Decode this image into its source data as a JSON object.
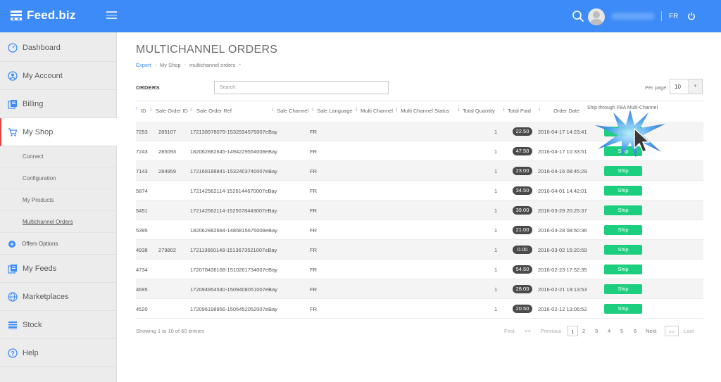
{
  "header": {
    "logo_text": "Feed.biz",
    "language": "FR",
    "accent_color": "#3d8bf8"
  },
  "sidebar": {
    "items": [
      {
        "label": "Dashboard",
        "icon": "dashboard-icon"
      },
      {
        "label": "My Account",
        "icon": "user-icon"
      },
      {
        "label": "Billing",
        "icon": "billing-icon"
      },
      {
        "label": "My Shop",
        "icon": "cart-icon",
        "active": true
      },
      {
        "label": "My Feeds",
        "icon": "feeds-icon"
      },
      {
        "label": "Marketplaces",
        "icon": "globe-icon"
      },
      {
        "label": "Stock",
        "icon": "stock-icon"
      },
      {
        "label": "Help",
        "icon": "help-icon"
      }
    ],
    "sub_items": [
      "Connect",
      "Configuration",
      "My Products",
      "Multichannel Orders"
    ],
    "offers_label": "Offers Options"
  },
  "page": {
    "title": "MULTICHANNEL ORDERS",
    "breadcrumb": [
      "Expert",
      "My Shop",
      "multichannel orders"
    ]
  },
  "toolbar": {
    "orders_label": "ORDERS",
    "search_placeholder": "Search:",
    "per_page_label": "Per page:",
    "per_page_value": "10"
  },
  "table": {
    "columns": [
      "ID",
      "Sale Order ID",
      "Sale Order Ref",
      "Sale Channel",
      "Sale Language",
      "Multi Channel",
      "Multi Channel Status",
      "Total Quantity",
      "Total Paid",
      "Order Date",
      "Ship through FBA Multi-Channel"
    ],
    "rows": [
      {
        "id": "7253",
        "sale_order_id": "285107",
        "sale_order_ref": "172138978079-1532934575007eBay",
        "lang": "FR",
        "qty": "1",
        "paid": "22.50",
        "date": "2016-04-17 14:23:41",
        "action": "Ship"
      },
      {
        "id": "7243",
        "sale_order_id": "285093",
        "sale_order_ref": "182062882645-1494229554008eBay",
        "lang": "FR",
        "qty": "1",
        "paid": "47.50",
        "date": "2016-04-17 10:33:51",
        "action": "Ship"
      },
      {
        "id": "7143",
        "sale_order_id": "284959",
        "sale_order_ref": "172168188841-1532403740007eBay",
        "lang": "FR",
        "qty": "1",
        "paid": "23.00",
        "date": "2016-04-16 08:45:29",
        "action": "Ship"
      },
      {
        "id": "5874",
        "sale_order_id": "",
        "sale_order_ref": "172142562114-1526144670007eBay",
        "lang": "FR",
        "qty": "1",
        "paid": "34.50",
        "date": "2016-04-01 14:42:01",
        "action": "Ship"
      },
      {
        "id": "5451",
        "sale_order_id": "",
        "sale_order_ref": "172142562114-1525078443007eBay",
        "lang": "FR",
        "qty": "1",
        "paid": "39.00",
        "date": "2016-03-29 20:25:37",
        "action": "Ship"
      },
      {
        "id": "5395",
        "sale_order_id": "",
        "sale_order_ref": "182062882684-1485815675008eBay",
        "lang": "FR",
        "qty": "1",
        "paid": "21.00",
        "date": "2016-03-28 08:50:36",
        "action": "Ship"
      },
      {
        "id": "4938",
        "sale_order_id": "279802",
        "sale_order_ref": "172113660148-1513673521007eBay",
        "lang": "FR",
        "qty": "1",
        "paid": "0.00",
        "date": "2016-03-02 15:20:59",
        "action": "Ship"
      },
      {
        "id": "4734",
        "sale_order_id": "",
        "sale_order_ref": "172078436168-1510261734007eBay",
        "lang": "FR",
        "qty": "1",
        "paid": "54.50",
        "date": "2016-02-23 17:52:35",
        "action": "Ship"
      },
      {
        "id": "4695",
        "sale_order_id": "",
        "sale_order_ref": "172094954540-1509408051007eBay",
        "lang": "FR",
        "qty": "1",
        "paid": "28.00",
        "date": "2016-02-21 19:13:53",
        "action": "Ship"
      },
      {
        "id": "4520",
        "sale_order_id": "",
        "sale_order_ref": "172096198956-1505452052007eBay",
        "lang": "FR",
        "qty": "1",
        "paid": "20.50",
        "date": "2016-02-12 13:06:52",
        "action": "Ship"
      }
    ]
  },
  "footer": {
    "entries_text": "Showing 1 to 10 of 60 entries",
    "first": "First",
    "prev_arrows": "<<",
    "previous": "Previous",
    "pages": [
      "1",
      "2",
      "3",
      "4",
      "5",
      "6"
    ],
    "next": "Next",
    "next_arrows": ">>",
    "last": "Last",
    "current_page": "1"
  },
  "colors": {
    "ship_button": "#1ccf7f",
    "paid_badge": "#4a4a4a",
    "active_marker": "#e0443d"
  }
}
